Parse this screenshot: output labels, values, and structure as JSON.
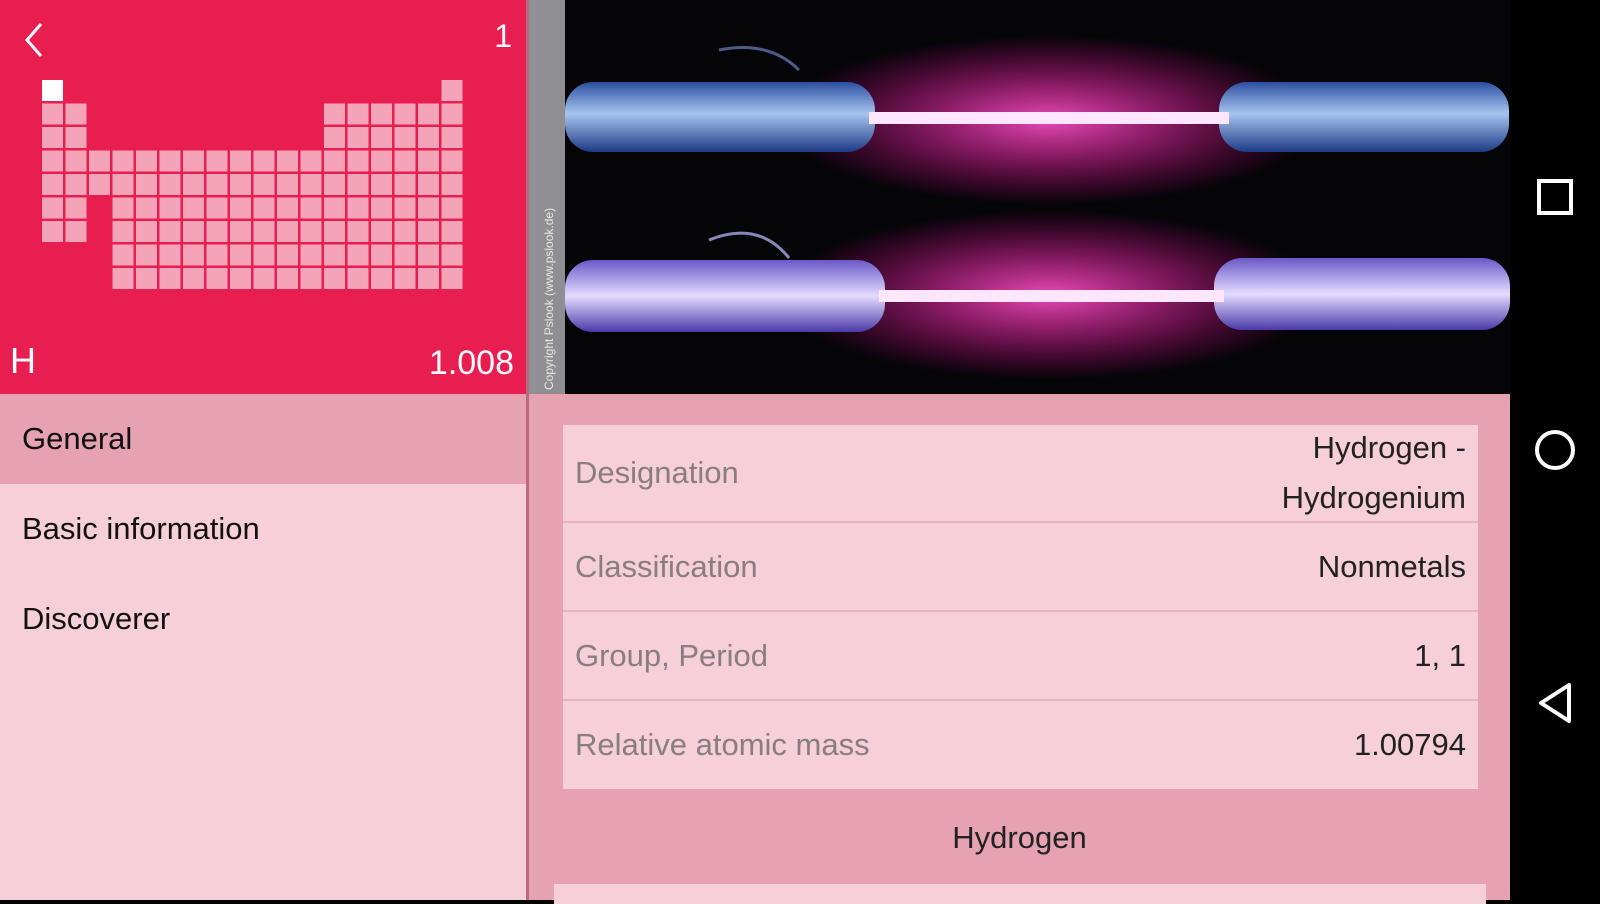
{
  "element": {
    "atomic_number": "1",
    "symbol": "H",
    "mass": "1.008",
    "card_color": "#e91e50"
  },
  "photo": {
    "credit": "Copyright Pslook (www.pslook.de)"
  },
  "menu": {
    "items": [
      {
        "label": "General",
        "active": true
      },
      {
        "label": "Basic information",
        "active": false
      },
      {
        "label": "Discoverer",
        "active": false
      }
    ]
  },
  "details": {
    "rows": [
      {
        "label": "Designation",
        "value_line1": "Hydrogen -",
        "value_line2": "Hydrogenium"
      },
      {
        "label": "Classification",
        "value": "Nonmetals"
      },
      {
        "label": "Group, Period",
        "value": "1, 1"
      },
      {
        "label": "Relative atomic mass",
        "value": "1.00794"
      }
    ],
    "section_title": "Hydrogen"
  },
  "icons": {
    "back": "chevron-left-icon",
    "recents": "square-icon",
    "home": "circle-icon",
    "nav_back": "triangle-back-icon"
  }
}
